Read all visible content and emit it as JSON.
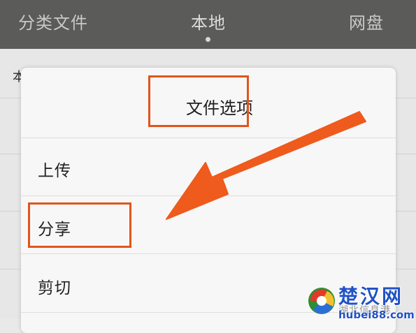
{
  "tabs": {
    "category": "分类文件",
    "local": "本地",
    "cloud": "网盘"
  },
  "background_list": {
    "first_row_text": "本"
  },
  "dialog": {
    "title": "文件选项",
    "items": [
      "上传",
      "分享",
      "剪切"
    ]
  },
  "annotation": {
    "color": "#e2541b"
  },
  "watermark": {
    "title": "楚汉网",
    "subtitle": "湖北信息港",
    "url": "hubei88.com"
  }
}
